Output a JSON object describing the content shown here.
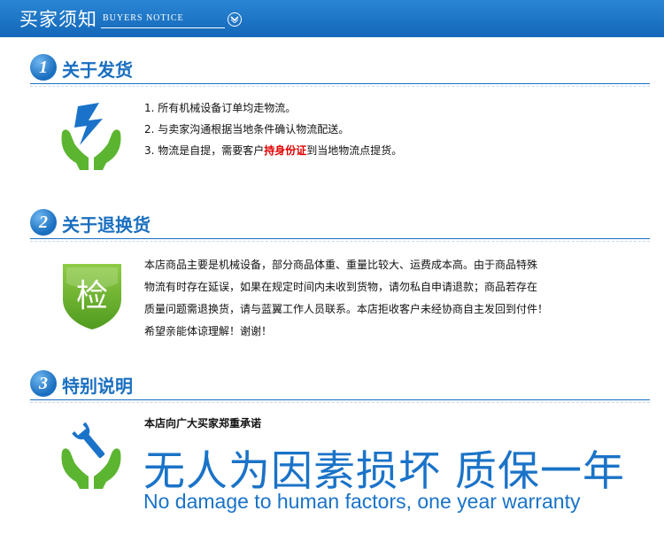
{
  "header": {
    "title": "买家须知",
    "subtitle": "BUYERS NOTICE"
  },
  "sections": [
    {
      "number": "1",
      "title": "关于发货",
      "items": [
        "1. 所有机械设备订单均走物流。",
        "2. 与卖家沟通根据当地条件确认物流配送。"
      ],
      "item3": {
        "before": "3. 物流是自提，需要客户",
        "highlight": "持身份证",
        "after": "到当地物流点提货。"
      }
    },
    {
      "number": "2",
      "title": "关于退换货",
      "icon_char": "检",
      "paragraph_lines": [
        "本店商品主要是机械设备，部分商品体重、重量比较大、运费成本高。由于商品特殊",
        "物流有时存在延误，如果在规定时间内未收到货物，请勿私自申请退款；商品若存在",
        "质量问题需退换货，请与蓝翼工作人员联系。本店拒收客户未经协商自主发回到付件！",
        "希望亲能体谅理解！谢谢！"
      ]
    },
    {
      "number": "3",
      "title": "特别说明",
      "promise": "本店向广大买家郑重承诺",
      "slogan_cn": "无人为因素损坏  质保一年",
      "slogan_en": "No damage to human factors, one year warranty"
    }
  ],
  "colors": {
    "brand_blue": "#1a6fc0",
    "highlight_red": "#e00000",
    "hand_green": "#5cb531",
    "shield_green": "#6cb02e"
  },
  "icons": [
    "chevron-down-icon",
    "lightning-hands-icon",
    "inspection-shield-icon",
    "wrench-hands-icon"
  ]
}
